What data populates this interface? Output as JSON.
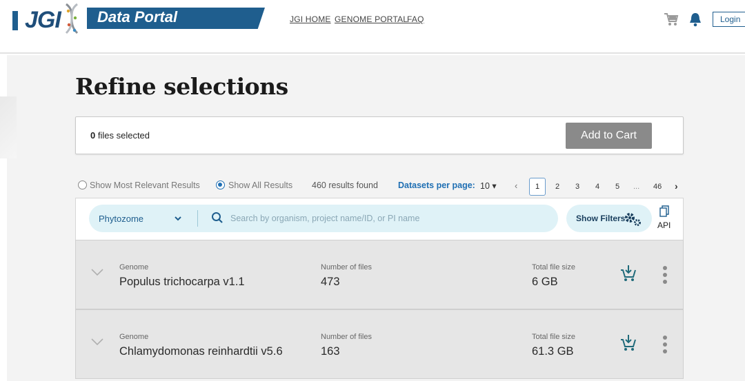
{
  "header": {
    "logo_text": "JGI",
    "portal_title": "Data Portal",
    "nav": [
      "JGI HOME",
      "GENOME PORTAL",
      "FAQ"
    ],
    "login_label": "Login"
  },
  "page_title": "Refine selections",
  "selection": {
    "count": "0",
    "suffix": "files selected",
    "add_to_cart_label": "Add to Cart"
  },
  "options": {
    "most_relevant_label": "Show Most Relevant Results",
    "all_results_label": "Show All Results",
    "results_found": "460 results found",
    "per_page_label": "Datasets per page:",
    "per_page_value": "10 ▾",
    "pages": [
      "1",
      "2",
      "3",
      "4",
      "5",
      "...",
      "46"
    ],
    "prev": "‹",
    "next": "›"
  },
  "search": {
    "portal_select": "Phytozome",
    "placeholder": "Search by organism, project name/ID, or PI name",
    "filters_label": "Show Filters",
    "api_label": "API"
  },
  "results": [
    {
      "type_label": "Genome",
      "name": "Populus trichocarpa v1.1",
      "files_label": "Number of files",
      "files": "473",
      "size_label": "Total file size",
      "size": "6 GB"
    },
    {
      "type_label": "Genome",
      "name": "Chlamydomonas reinhardtii v5.6",
      "files_label": "Number of files",
      "files": "163",
      "size_label": "Total file size",
      "size": "61.3 GB"
    }
  ],
  "colors": {
    "brand": "#1f5e8e",
    "accent": "#1f6fb3",
    "pill_bg": "#dff2f7",
    "cart_icon": "#1f6a7a",
    "row_bg": "#e6e6e6"
  }
}
